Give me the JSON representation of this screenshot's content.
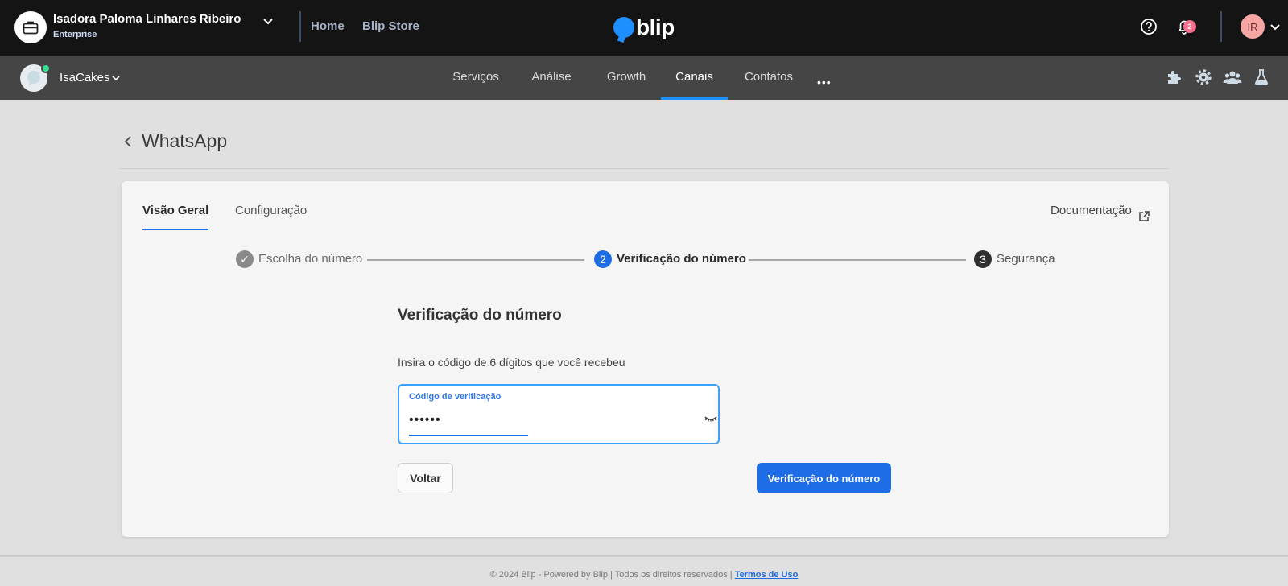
{
  "topbar": {
    "org_name": "Isadora Paloma Linhares Ribeiro",
    "org_plan": "Enterprise",
    "links": [
      "Home",
      "Blip Store"
    ],
    "logo_text": "blip",
    "notification_count": "2",
    "user_initials": "IR"
  },
  "subnav": {
    "bot_name": "IsaCakes",
    "items": [
      "Serviços",
      "Análise",
      "Growth",
      "Canais",
      "Contatos"
    ],
    "active_item": "Canais",
    "more": "•••"
  },
  "page": {
    "title": "WhatsApp"
  },
  "card": {
    "tabs": [
      "Visão Geral",
      "Configuração"
    ],
    "active_tab": "Visão Geral",
    "doc_link": "Documentação",
    "steps": [
      {
        "number": "✓",
        "label": "Escolha do número",
        "state": "done"
      },
      {
        "number": "2",
        "label": "Verificação do número",
        "state": "current"
      },
      {
        "number": "3",
        "label": "Segurança",
        "state": "pending"
      }
    ],
    "form": {
      "title": "Verificação do número",
      "description": "Insira o código de 6 dígitos que você recebeu",
      "field_label": "Código de verificação",
      "field_value": "••••••",
      "back_label": "Voltar",
      "submit_label": "Verificação do número"
    }
  },
  "footer": {
    "text": "© 2024 Blip - Powered by Blip | Todos os direitos reservados | ",
    "link": "Termos de Uso"
  },
  "colors": {
    "accent": "#1e6ce6",
    "topbar_bg": "#141414",
    "subnav_bg": "#454545",
    "page_bg": "#e0e0e0",
    "badge": "#f76f8c",
    "status_online": "#35de90"
  }
}
